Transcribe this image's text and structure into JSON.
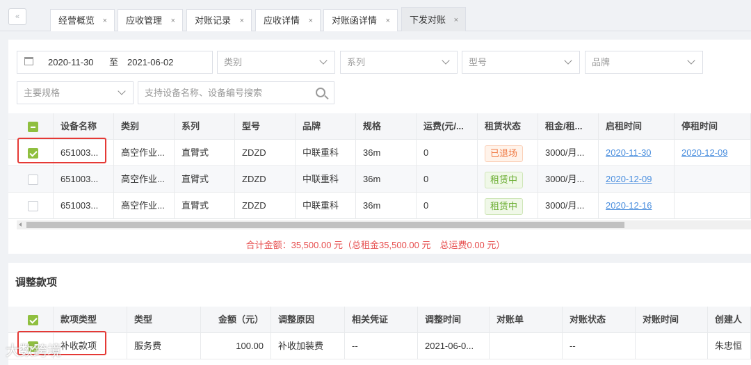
{
  "tabs": [
    {
      "label": "经营概览"
    },
    {
      "label": "应收管理"
    },
    {
      "label": "对账记录"
    },
    {
      "label": "应收详情"
    },
    {
      "label": "对账函详情"
    },
    {
      "label": "下发对账"
    }
  ],
  "tab_close": "×",
  "back_icon": "«",
  "filters": {
    "date_start": "2020-11-30",
    "date_sep": "至",
    "date_end": "2021-06-02",
    "category_placeholder": "类别",
    "series_placeholder": "系列",
    "model_placeholder": "型号",
    "brand_placeholder": "品牌",
    "spec_placeholder": "主要规格",
    "search_placeholder": "支持设备名称、设备编号搜索"
  },
  "equipment_table": {
    "columns": [
      "设备名称",
      "类别",
      "系列",
      "型号",
      "品牌",
      "规格",
      "运费(元/...",
      "租赁状态",
      "租金/租...",
      "启租时间",
      "停租时间"
    ],
    "rows": [
      {
        "checked": true,
        "name": "651003...",
        "category": "高空作业...",
        "series": "直臂式",
        "model": "ZDZD",
        "brand": "中联重科",
        "spec": "36m",
        "freight": "0",
        "status": "已退场",
        "status_color": "orange",
        "rent": "3000/月...",
        "start": "2020-11-30",
        "stop": "2020-12-09"
      },
      {
        "checked": false,
        "name": "651003...",
        "category": "高空作业...",
        "series": "直臂式",
        "model": "ZDZD",
        "brand": "中联重科",
        "spec": "36m",
        "freight": "0",
        "status": "租赁中",
        "status_color": "green",
        "rent": "3000/月...",
        "start": "2020-12-09",
        "stop": ""
      },
      {
        "checked": false,
        "name": "651003...",
        "category": "高空作业...",
        "series": "直臂式",
        "model": "ZDZD",
        "brand": "中联重科",
        "spec": "36m",
        "freight": "0",
        "status": "租赁中",
        "status_color": "green",
        "rent": "3000/月...",
        "start": "2020-12-16",
        "stop": ""
      }
    ]
  },
  "total": "合计金额：35,500.00 元（总租金35,500.00 元　总运费0.00 元）",
  "adjust": {
    "title": "调整款项",
    "columns": [
      "款项类型",
      "类型",
      "金额（元）",
      "调整原因",
      "相关凭证",
      "调整时间",
      "对账单",
      "对账状态",
      "对账时间",
      "创建人"
    ],
    "row": {
      "item_type": "补收款项",
      "type": "服务费",
      "amount": "100.00",
      "reason": "补收加装费",
      "voucher": "--",
      "time": "2021-06-0...",
      "statement": "",
      "status": "--",
      "recon_time": "",
      "creator": "朱忠恒"
    }
  },
  "watermark": "大数跨境",
  "colors": {
    "accent": "#8fbf3f",
    "link": "#4a8ede",
    "total": "#e64d4d",
    "highlight": "#e53935"
  }
}
